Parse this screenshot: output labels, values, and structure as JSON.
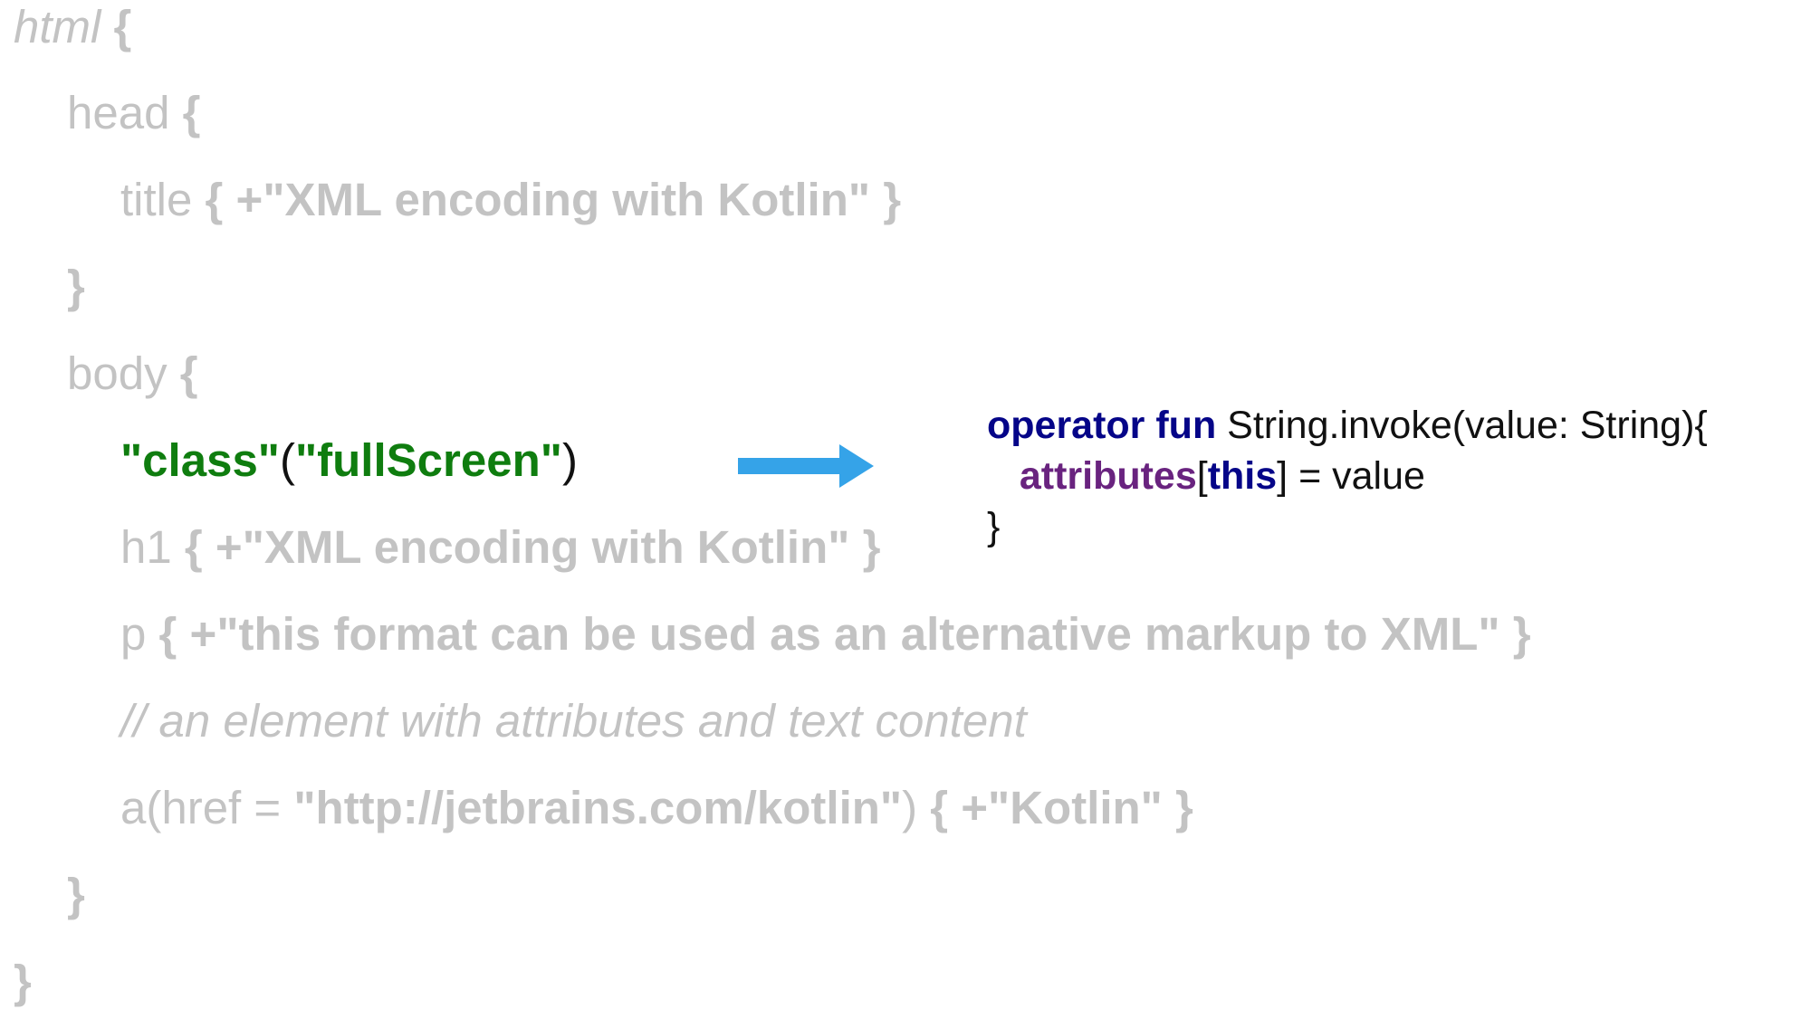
{
  "code": {
    "l0": {
      "kw": "html",
      "brace": " {"
    },
    "l1": {
      "kw": "head",
      "brace": " {"
    },
    "l2": {
      "kw": "title",
      "open": " { +",
      "str": "\"XML encoding with Kotlin\"",
      "close": " }"
    },
    "l3": {
      "brace": "}"
    },
    "l4": {
      "kw": "body",
      "brace": " {"
    },
    "l5": {
      "attr": "\"class\"",
      "open": "(",
      "val": "\"fullScreen\"",
      "close": ")"
    },
    "l6": {
      "kw": "h1",
      "open": " { +",
      "str": "\"XML encoding with Kotlin\"",
      "close": " }"
    },
    "l7": {
      "kw": "p",
      "open": " { +",
      "str": "\"this format can be used as an alternative markup to XML\"",
      "close": " }"
    },
    "l8": {
      "comment": "// an element with attributes and text content"
    },
    "l9": {
      "kw": "a(href = ",
      "str": "\"http://jetbrains.com/kotlin\"",
      "paren": ")",
      "open": " { +",
      "str2": "\"Kotlin\"",
      "close": " }"
    },
    "l10": {
      "brace": "}"
    },
    "l11": {
      "brace": "}"
    }
  },
  "operator": {
    "line1": {
      "kw": "operator fun",
      "rest": " String.invoke(value: String){"
    },
    "line2": {
      "indent": "   ",
      "prop": "attributes",
      "lb": "[",
      "this": "this",
      "rb": "]",
      "rest": " = value"
    },
    "line3": {
      "brace": "}"
    }
  },
  "colors": {
    "faded_code": "#c3c3c3",
    "string_green": "#0f7d0f",
    "keyword_navy": "#050588",
    "property_purple": "#69237f",
    "arrow_blue": "#35a3e8"
  },
  "icons": {
    "arrow": "right-arrow-icon"
  }
}
